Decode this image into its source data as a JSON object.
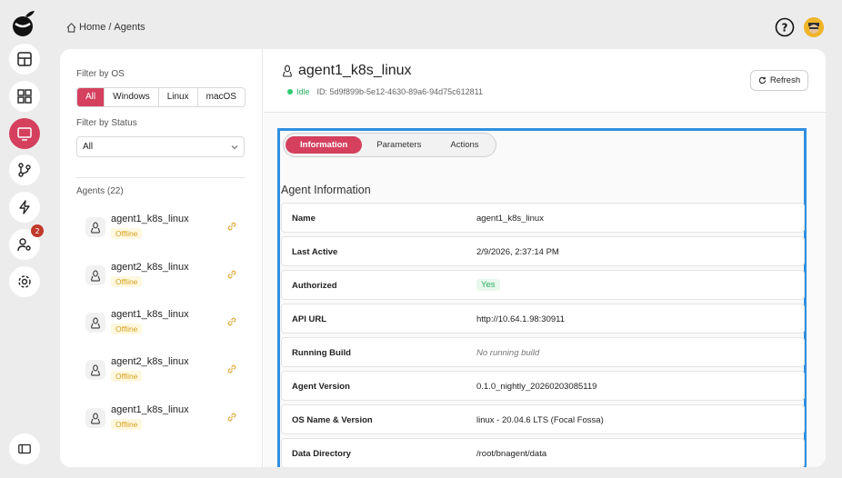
{
  "breadcrumb": {
    "home": "Home",
    "sep": "/",
    "current": "Agents"
  },
  "rail": {
    "notification_count": "2",
    "accent": "#d4405e"
  },
  "filters": {
    "os_label": "Filter by OS",
    "os_options": [
      "All",
      "Windows",
      "Linux",
      "macOS"
    ],
    "os_selected": "All",
    "status_label": "Filter by Status",
    "status_value": "All"
  },
  "agents_list": {
    "heading": "Agents (22)",
    "items": [
      {
        "name": "agent1_k8s_linux",
        "status": "Offline"
      },
      {
        "name": "agent2_k8s_linux",
        "status": "Offline"
      },
      {
        "name": "agent1_k8s_linux",
        "status": "Offline"
      },
      {
        "name": "agent2_k8s_linux",
        "status": "Offline"
      },
      {
        "name": "agent1_k8s_linux",
        "status": "Offline"
      }
    ]
  },
  "detail": {
    "title": "agent1_k8s_linux",
    "state": "Idle",
    "id_text": "ID: 5d9f899b-5e12-4630-89a6-94d75c612811",
    "refresh_label": "Refresh",
    "tabs": [
      "Information",
      "Parameters",
      "Actions"
    ],
    "active_tab": "Information",
    "section_title": "Agent Information",
    "fields": [
      {
        "key": "Name",
        "value": "agent1_k8s_linux"
      },
      {
        "key": "Last Active",
        "value": "2/9/2026, 2:37:14 PM"
      },
      {
        "key": "Authorized",
        "value": "Yes"
      },
      {
        "key": "API URL",
        "value": "http://10.64.1.98:30911"
      },
      {
        "key": "Running Build",
        "value": "No running build"
      },
      {
        "key": "Agent Version",
        "value": "0.1.0_nightly_20260203085119"
      },
      {
        "key": "OS Name & Version",
        "value": "linux - 20.04.6 LTS (Focal Fossa)"
      },
      {
        "key": "Data Directory",
        "value": "/root/bnagent/data"
      }
    ]
  }
}
